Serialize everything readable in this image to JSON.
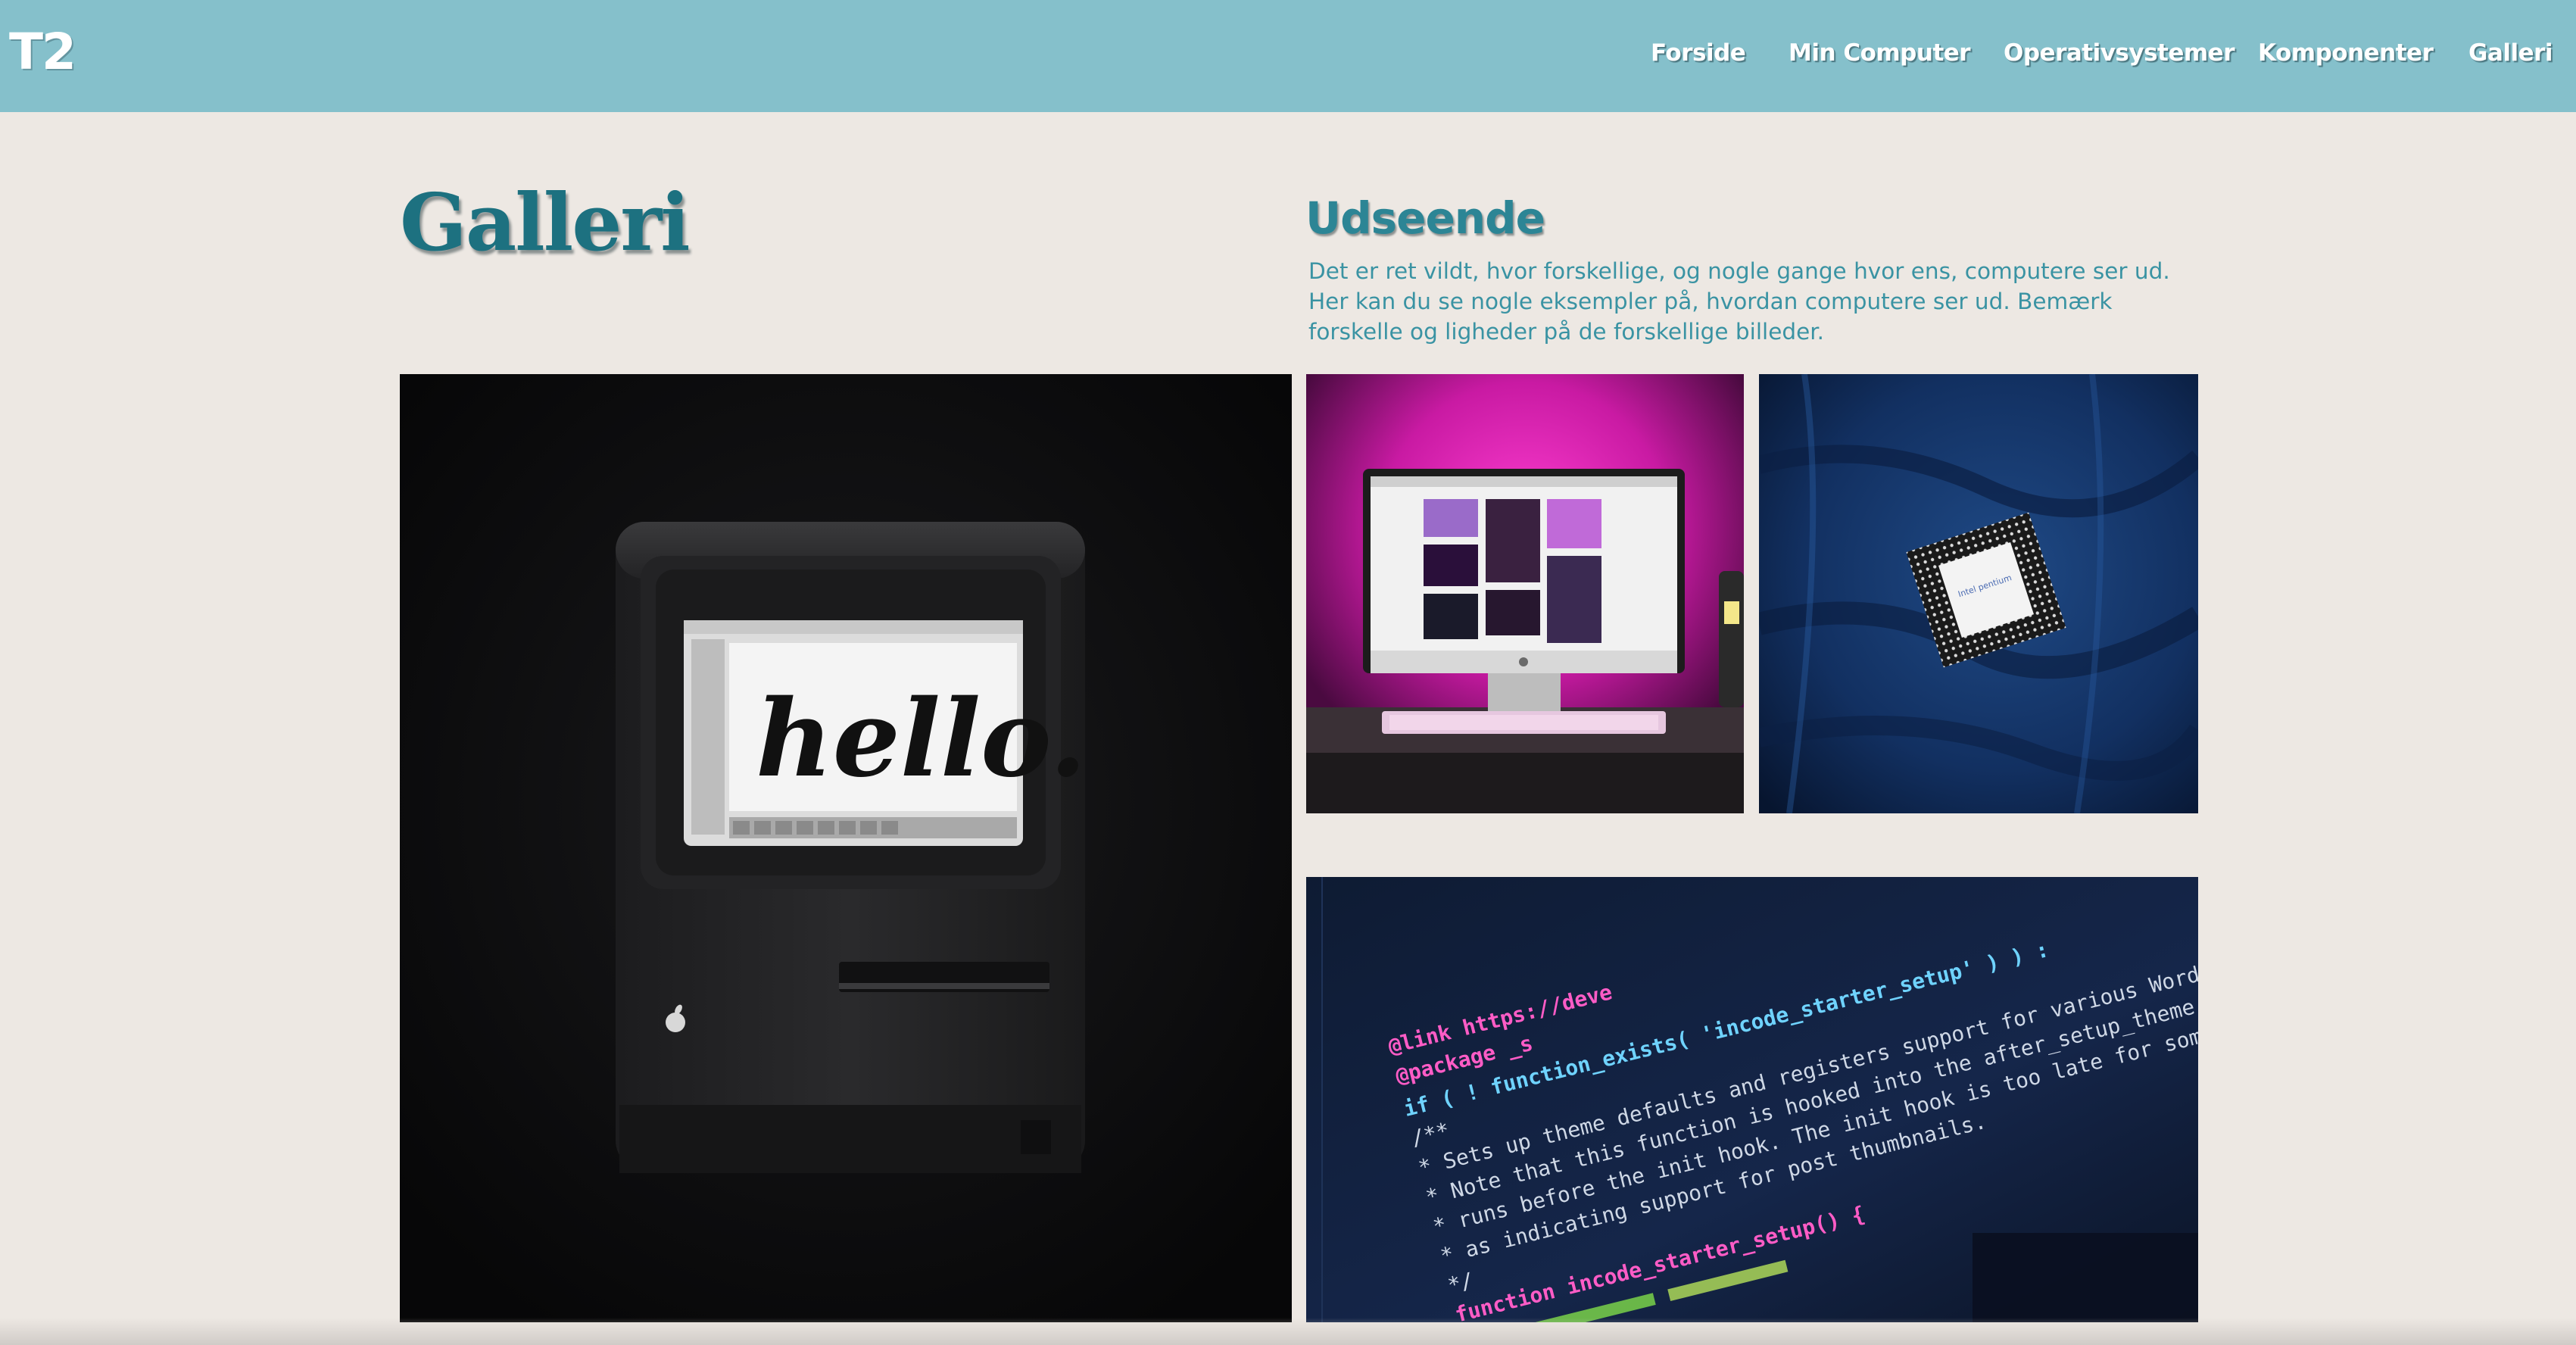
{
  "header": {
    "logo": "T2",
    "nav": [
      {
        "label": "Forside"
      },
      {
        "label": "Min Computer"
      },
      {
        "label": "Operativsystemer"
      },
      {
        "label": "Komponenter"
      },
      {
        "label": "Galleri"
      }
    ],
    "background_color": "#85c0cb"
  },
  "main": {
    "title": "Galleri",
    "section_title": "Udseende",
    "section_text": "Det er ret vildt, hvor forskellige, og nogle gange hvor ens, computere ser ud. Her kan du se nogle eksempler på, hvordan computere ser ud. Bemærk forskelle og ligheder på de forskellige billeder.",
    "accent_color": "#1d7180"
  },
  "gallery": {
    "mac_screen_text": "hello.",
    "cpu_label": "Intel pentium",
    "code_lines": [
      "@link https://deve",
      "@package _s",
      "if ( ! function_exists( 'incode_starter_setup' ) ) :",
      "/**",
      " * Sets up theme defaults and registers support for various WordPress feat",
      " * Note that this function is hooked into the after_setup_theme hook, which",
      " * runs before the init hook. The init hook is too late for some features,",
      " * as indicating support for post thumbnails.",
      " */",
      "function incode_starter_setup() {"
    ]
  }
}
